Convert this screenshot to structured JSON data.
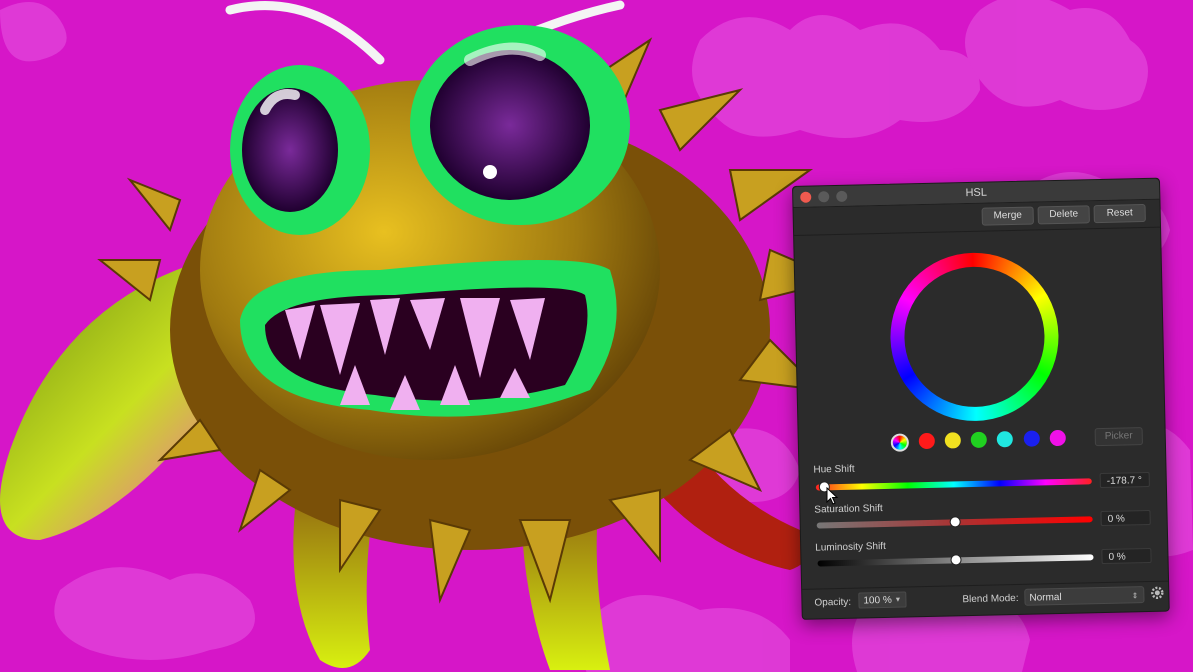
{
  "colors": {
    "background": "#d616c8",
    "panel": "#2b2b2b",
    "close": "#f05a4f"
  },
  "window": {
    "title": "HSL"
  },
  "toolbar": {
    "merge_label": "Merge",
    "delete_label": "Delete",
    "reset_label": "Reset"
  },
  "swatches": [
    "master",
    "red",
    "yellow",
    "green",
    "cyan",
    "blue",
    "magenta"
  ],
  "picker_label": "Picker",
  "hue": {
    "label": "Hue Shift",
    "value": "-178.7 °",
    "level": 0.03
  },
  "saturation": {
    "label": "Saturation Shift",
    "value": "0 %",
    "level": 0.5
  },
  "luminosity": {
    "label": "Luminosity Shift",
    "value": "0 %",
    "level": 0.5
  },
  "footer": {
    "opacity_label": "Opacity:",
    "opacity_value": "100 %",
    "blend_label": "Blend Mode:",
    "blend_value": "Normal"
  }
}
